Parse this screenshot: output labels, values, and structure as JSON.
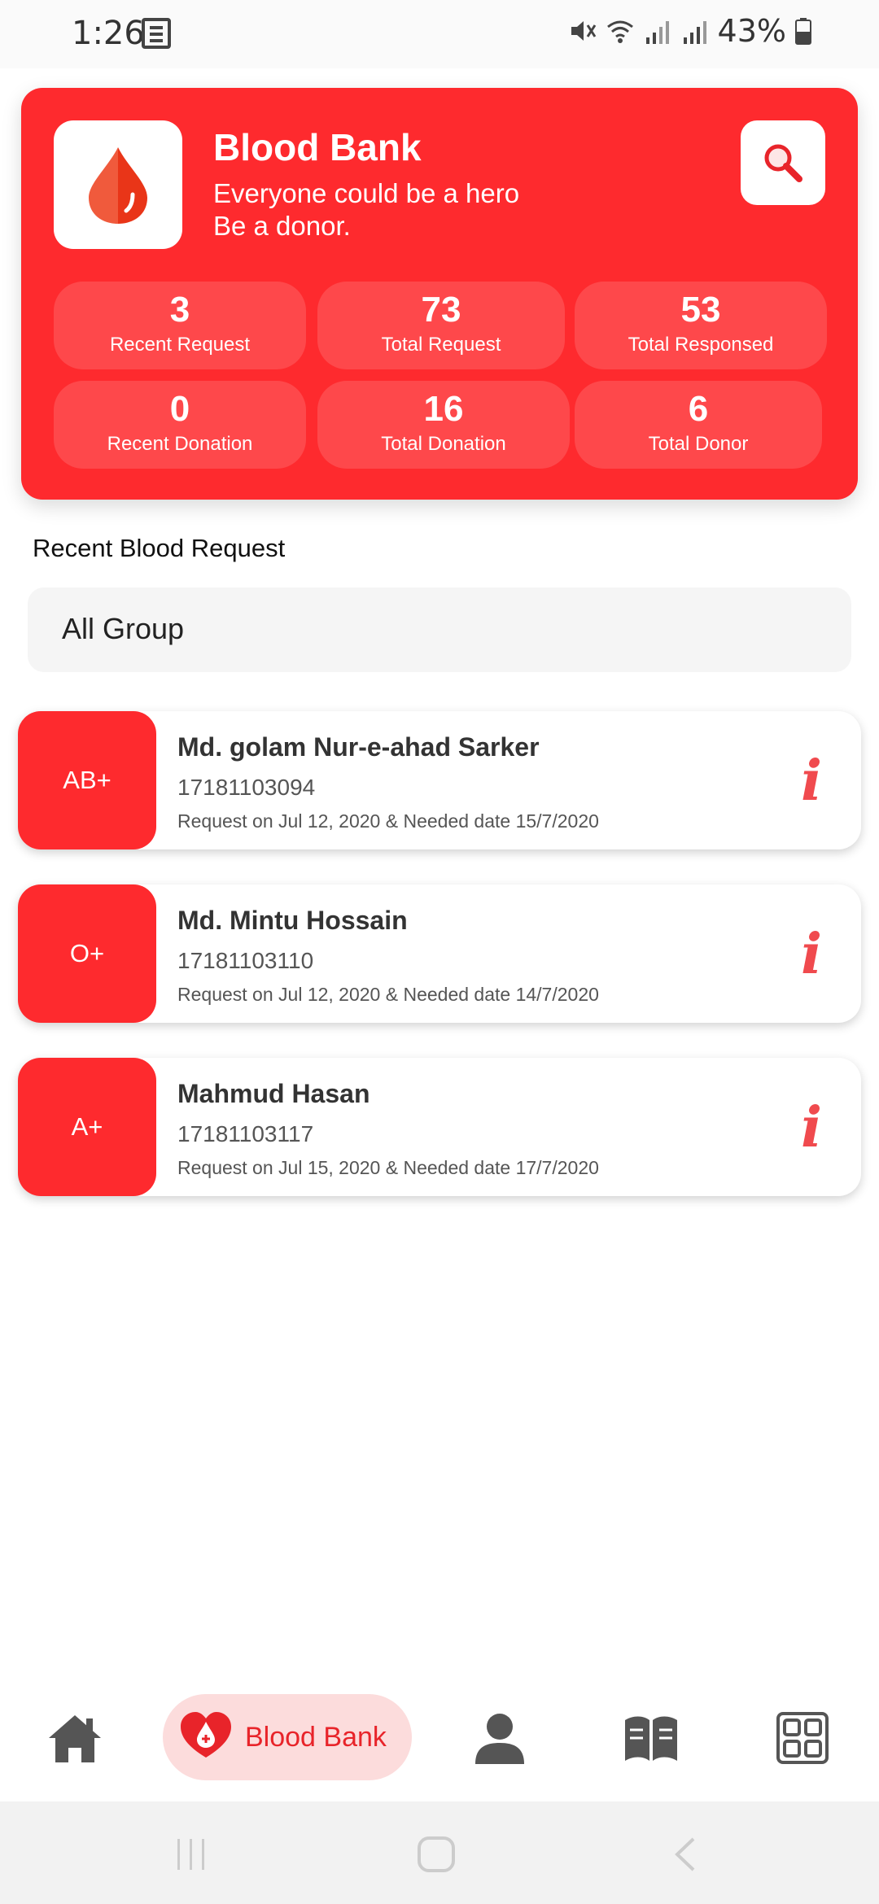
{
  "status_bar": {
    "time": "1:26",
    "battery": "43%"
  },
  "header": {
    "title": "Blood Bank",
    "tagline_line1": "Everyone could be a hero",
    "tagline_line2": "Be a donor."
  },
  "stats": [
    {
      "value": "3",
      "label": "Recent Request"
    },
    {
      "value": "73",
      "label": "Total Request"
    },
    {
      "value": "53",
      "label": "Total Responsed"
    },
    {
      "value": "0",
      "label": "Recent Donation"
    },
    {
      "value": "16",
      "label": "Total Donation"
    },
    {
      "value": "6",
      "label": "Total Donor"
    }
  ],
  "section": {
    "title": "Recent Blood Request",
    "group_filter": "All Group"
  },
  "requests": [
    {
      "group": "AB+",
      "name": "Md. golam Nur-e-ahad Sarker",
      "phone": "17181103094",
      "meta": "Request on Jul 12, 2020 & Needed date 15/7/2020"
    },
    {
      "group": "O+",
      "name": "Md. Mintu Hossain",
      "phone": "17181103110",
      "meta": "Request on Jul 12, 2020 & Needed date 14/7/2020"
    },
    {
      "group": "A+",
      "name": "Mahmud Hasan",
      "phone": "17181103117",
      "meta": "Request on Jul 15, 2020 & Needed date 17/7/2020"
    }
  ],
  "bottom_nav": {
    "active_label": "Blood Bank",
    "items": [
      "home-icon",
      "blood-bank-icon",
      "profile-icon",
      "book-icon",
      "grid-icon"
    ]
  },
  "colors": {
    "primary": "#fe2a2e",
    "active_pill": "#fcdcdc"
  }
}
